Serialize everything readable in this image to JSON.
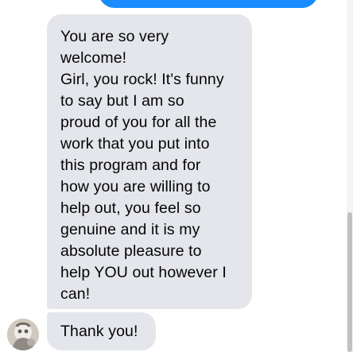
{
  "conversation": {
    "outgoing_bubble_color": "#1a8cff",
    "incoming_bubble_color": "#e4e6eb",
    "messages": [
      {
        "sender": "contact",
        "lines": [
          "You are so very",
          "welcome!",
          "Girl, you rock! It's funny",
          "to say but I am so",
          "proud of you for all the",
          "work that you put into",
          "this program and for",
          "how you are willing to",
          "help out, you feel so",
          "genuine and it is my",
          "absolute pleasure to",
          "help YOU out however I",
          "can!"
        ]
      },
      {
        "sender": "contact",
        "text": "Thank you!"
      }
    ]
  },
  "avatar": {
    "icon": "contact-avatar-photo"
  }
}
